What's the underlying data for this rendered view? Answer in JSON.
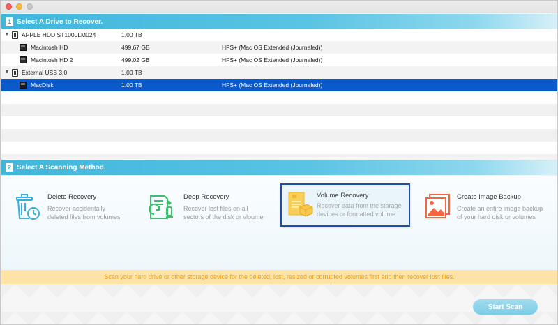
{
  "window": {
    "controls": [
      "close",
      "minimize",
      "zoom"
    ]
  },
  "step1": {
    "number": "1",
    "title": "Select A Drive to Recover."
  },
  "drives": [
    {
      "name": "APPLE HDD ST1000LM024",
      "size": "1.00 TB",
      "fs": "",
      "kind": "device",
      "icon": "hard-drive-icon",
      "disclosure": "▼"
    },
    {
      "name": "Macintosh HD",
      "size": "499.67 GB",
      "fs": "HFS+ (Mac OS Extended (Journaled))",
      "kind": "volume",
      "icon": "volume-icon"
    },
    {
      "name": "Macintosh HD 2",
      "size": "499.02 GB",
      "fs": "HFS+ (Mac OS Extended (Journaled))",
      "kind": "volume",
      "icon": "volume-icon"
    },
    {
      "name": "External USB 3.0",
      "size": "1.00 TB",
      "fs": "",
      "kind": "device",
      "icon": "usb-drive-icon",
      "disclosure": "▼"
    },
    {
      "name": "MacDisk",
      "size": "1.00 TB",
      "fs": "HFS+ (Mac OS Extended (Journaled))",
      "kind": "volume",
      "icon": "volume-icon",
      "selected": true
    }
  ],
  "step2": {
    "number": "2",
    "title": "Select A Scanning Method."
  },
  "methods": [
    {
      "title": "Delete Recovery",
      "desc1": "Recover accidentally",
      "desc2": "deleted files from volumes",
      "icon": "trash-clock-icon",
      "color": "#35aee0"
    },
    {
      "title": "Deep Recovery",
      "desc1": "Recover lost files on all",
      "desc2": "sectors of the disk or vloume",
      "icon": "deep-scan-icon",
      "color": "#3cbf6a"
    },
    {
      "title": "Volume Recovery",
      "desc1": "Recover data from the storage",
      "desc2": "devices or formatted volume",
      "icon": "volume-recovery-icon",
      "color": "#f7c23d",
      "selected": true
    },
    {
      "title": "Create Image Backup",
      "desc1": "Create an entire image backup",
      "desc2": "of your hard disk or volumes",
      "icon": "image-backup-icon",
      "color": "#f5663c"
    }
  ],
  "info": "Scan your hard drive or other storage device for the deleted, lost, resized or corrupted volumes first and then recover lost files.",
  "start_button": "Start Scan",
  "colors": {
    "header_blue": "#3fb6dc",
    "selection_blue": "#0b5ac9",
    "info_bar_bg": "#fde3a5",
    "info_text": "#f0a11b",
    "button": "#7ccce6"
  }
}
